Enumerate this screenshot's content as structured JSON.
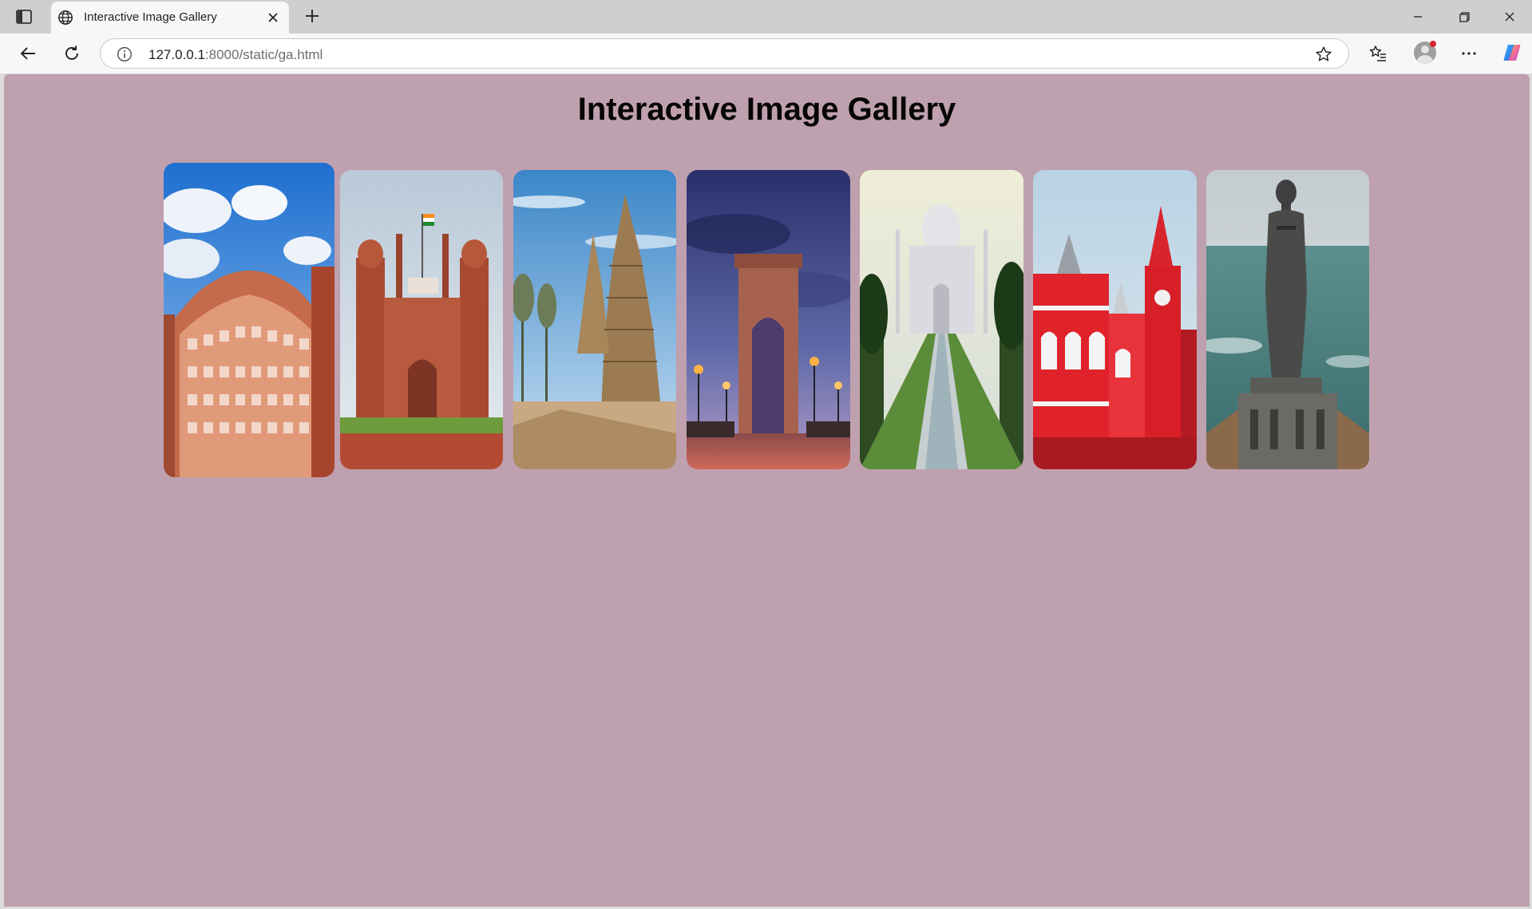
{
  "browser": {
    "tab_title": "Interactive Image Gallery",
    "url_host": "127.0.0.1",
    "url_rest": ":8000/static/ga.html"
  },
  "page": {
    "title": "Interactive Image Gallery",
    "background": "#bfa0ae"
  },
  "gallery": {
    "images": [
      {
        "subject": "hawa-mahal"
      },
      {
        "subject": "red-fort"
      },
      {
        "subject": "shore-temple"
      },
      {
        "subject": "india-gate"
      },
      {
        "subject": "taj-mahal"
      },
      {
        "subject": "chennai-central"
      },
      {
        "subject": "thiruvalluvar-statue"
      }
    ]
  }
}
